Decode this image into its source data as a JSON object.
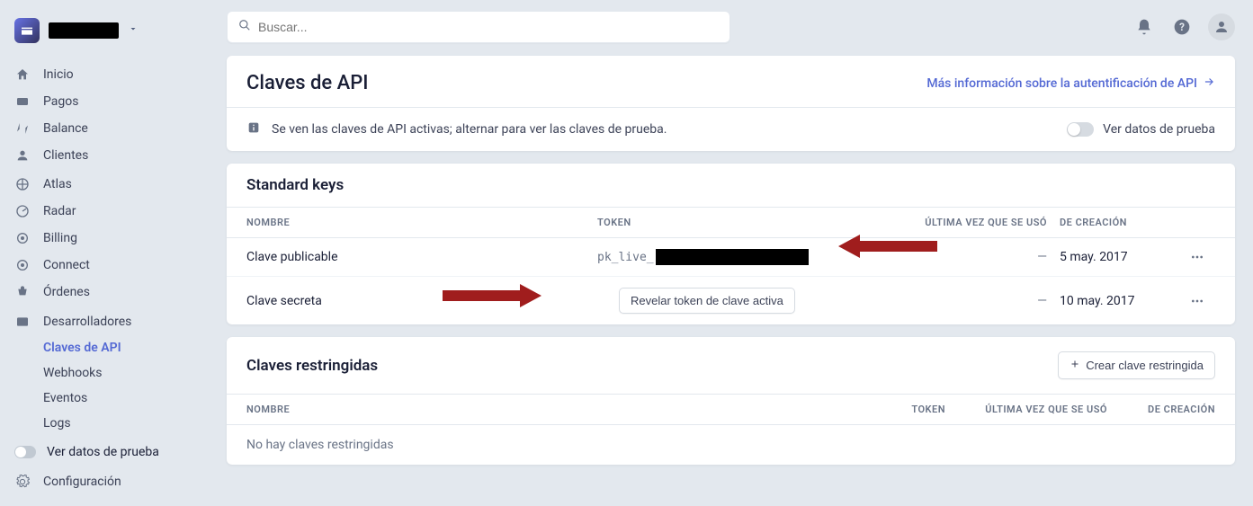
{
  "search_placeholder": "Buscar...",
  "nav": {
    "inicio": "Inicio",
    "pagos": "Pagos",
    "balance": "Balance",
    "clientes": "Clientes",
    "atlas": "Atlas",
    "radar": "Radar",
    "billing": "Billing",
    "connect": "Connect",
    "ordenes": "Órdenes",
    "desarrolladores": "Desarrolladores",
    "claves_api": "Claves de API",
    "webhooks": "Webhooks",
    "eventos": "Eventos",
    "logs": "Logs",
    "ver_datos_prueba": "Ver datos de prueba",
    "configuracion": "Configuración"
  },
  "page": {
    "title": "Claves de API",
    "auth_link": "Más información sobre la autentificación de API",
    "notice": "Se ven las claves de API activas; alternar para ver las claves de prueba.",
    "toggle_label": "Ver datos de prueba"
  },
  "standard_keys": {
    "title": "Standard keys",
    "cols": {
      "name": "NOMBRE",
      "token": "TOKEN",
      "last": "ÚLTIMA VEZ QUE SE USÓ",
      "created": "DE CREACIÓN"
    },
    "rows": [
      {
        "name": "Clave publicable",
        "token_prefix": "pk_live_",
        "last_used": "—",
        "created": "5 may. 2017",
        "revealable": false
      },
      {
        "name": "Clave secreta",
        "reveal_label": "Revelar token de clave activa",
        "last_used": "—",
        "created": "10 may. 2017",
        "revealable": true
      }
    ]
  },
  "restricted_keys": {
    "title": "Claves restringidas",
    "create_label": "Crear clave restringida",
    "cols": {
      "name": "NOMBRE",
      "token": "TOKEN",
      "last": "ÚLTIMA VEZ QUE SE USÓ",
      "created": "DE CREACIÓN"
    },
    "empty": "No hay claves restringidas"
  }
}
